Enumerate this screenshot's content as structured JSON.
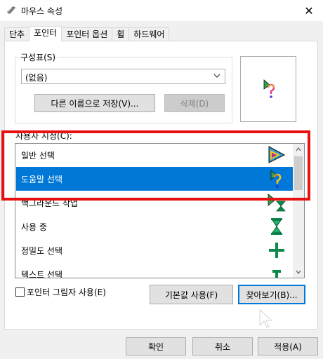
{
  "window": {
    "title": "마우스 속성",
    "close_symbol": "✕"
  },
  "tabs": [
    {
      "label": "단추"
    },
    {
      "label": "포인터",
      "active": true
    },
    {
      "label": "포인터 옵션"
    },
    {
      "label": "휠"
    },
    {
      "label": "하드웨어"
    }
  ],
  "scheme": {
    "group_label": "구성표(S)",
    "selected_value": "(없음)",
    "save_as_label": "다른 이름으로 저장(V)...",
    "delete_label": "삭제(D)"
  },
  "customize": {
    "label": "사용자 지정(C):",
    "items": [
      {
        "label": "일반 선택",
        "icon": "arrow-cursor-icon"
      },
      {
        "label": "도움말 선택",
        "icon": "help-cursor-icon",
        "selected": true
      },
      {
        "label": "백그라운드 작업",
        "icon": "working-in-background-icon"
      },
      {
        "label": "사용 중",
        "icon": "hourglass-icon"
      },
      {
        "label": "정밀도 선택",
        "icon": "crosshair-icon"
      },
      {
        "label": "텍스트 선택",
        "icon": "text-select-icon"
      }
    ]
  },
  "pointer_shadow_label": "포인터 그림자 사용(E)",
  "use_default_label": "기본값 사용(F)",
  "browse_label": "찾아보기(B)...",
  "footer": {
    "ok_label": "확인",
    "cancel_label": "취소",
    "apply_label": "적용(A)"
  },
  "colors": {
    "selection": "#0078d7",
    "highlight_border": "#e81010",
    "accent_green": "#0b8a4c"
  }
}
